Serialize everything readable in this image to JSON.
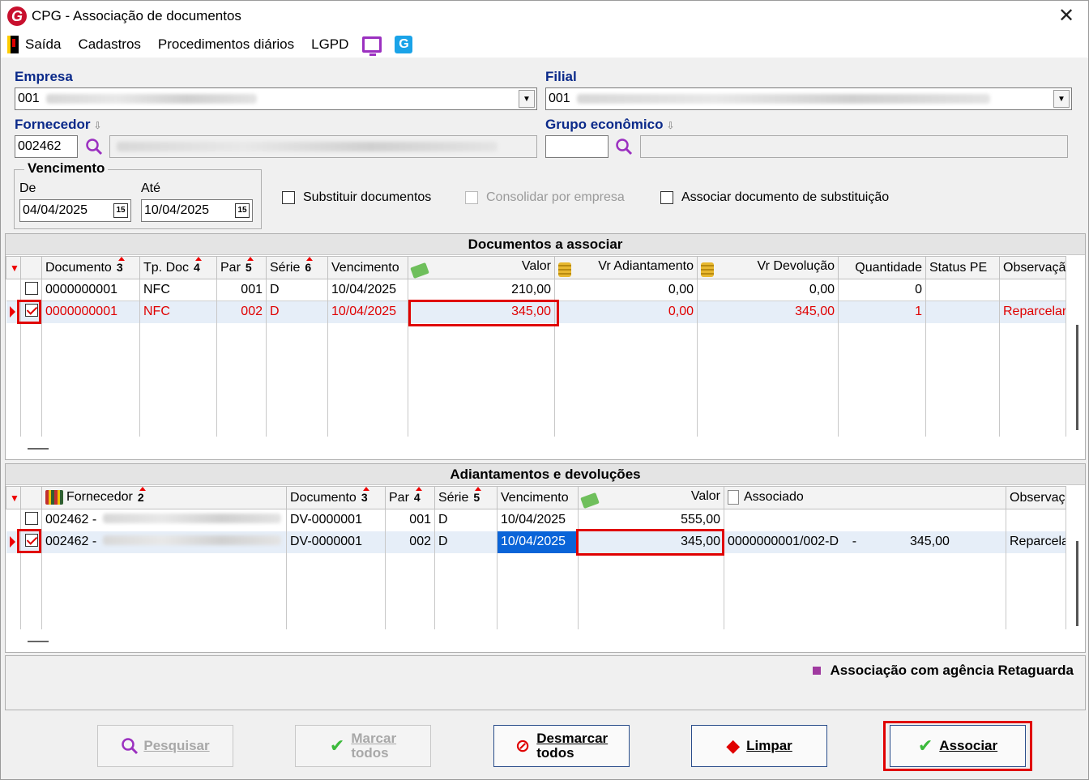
{
  "window": {
    "title": "CPG - Associação de documentos",
    "close": "✕"
  },
  "menu": {
    "items": [
      "Saída",
      "Cadastros",
      "Procedimentos diários",
      "LGPD"
    ]
  },
  "form": {
    "empresa_label": "Empresa",
    "empresa_value": "001",
    "filial_label": "Filial",
    "filial_value": "001",
    "fornecedor_label": "Fornecedor",
    "fornecedor_value": "002462",
    "grupo_label": "Grupo econômico",
    "grupo_value": "",
    "vencimento_label": "Vencimento",
    "de_label": "De",
    "de_value": "04/04/2025",
    "ate_label": "Até",
    "ate_value": "10/04/2025",
    "cal_glyph": "15",
    "chk_substituir": "Substituir documentos",
    "chk_consolidar": "Consolidar por empresa",
    "chk_associar_sub": "Associar documento de substituição"
  },
  "docs": {
    "title": "Documentos a associar",
    "headers": {
      "documento": "Documento",
      "documento_n": "3",
      "tpdoc": "Tp. Doc",
      "tpdoc_n": "4",
      "par": "Par",
      "par_n": "5",
      "serie": "Série",
      "serie_n": "6",
      "vencimento": "Vencimento",
      "valor": "Valor",
      "vradiant": "Vr Adiantamento",
      "vrdevol": "Vr Devolução",
      "quantidade": "Quantidade",
      "status": "Status PE",
      "observacao": "Observaçã"
    },
    "rows": [
      {
        "documento": "0000000001",
        "tpdoc": "NFC",
        "par": "001",
        "serie": "D",
        "vencimento": "10/04/2025",
        "valor": "210,00",
        "vradiant": "0,00",
        "vrdevol": "0,00",
        "quantidade": "0",
        "status": "",
        "observacao": ""
      },
      {
        "documento": "0000000001",
        "tpdoc": "NFC",
        "par": "002",
        "serie": "D",
        "vencimento": "10/04/2025",
        "valor": "345,00",
        "vradiant": "0,00",
        "vrdevol": "345,00",
        "quantidade": "1",
        "status": "",
        "observacao": "Reparcelar"
      }
    ]
  },
  "adiant": {
    "title": "Adiantamentos e devoluções",
    "headers": {
      "fornecedor": "Fornecedor",
      "fornecedor_n": "2",
      "documento": "Documento",
      "documento_n": "3",
      "par": "Par",
      "par_n": "4",
      "serie": "Série",
      "serie_n": "5",
      "vencimento": "Vencimento",
      "valor": "Valor",
      "associado": "Associado",
      "observacao": "Observaçã"
    },
    "rows": [
      {
        "fornecedor": "002462 -",
        "documento": "DV-0000001",
        "par": "001",
        "serie": "D",
        "vencimento": "10/04/2025",
        "valor": "555,00",
        "associado": "",
        "assoc_sep": "",
        "assoc_val": "",
        "observacao": ""
      },
      {
        "fornecedor": "002462 -",
        "documento": "DV-0000001",
        "par": "002",
        "serie": "D",
        "vencimento": "10/04/2025",
        "valor": "345,00",
        "associado": "0000000001/002-D",
        "assoc_sep": "-",
        "assoc_val": "345,00",
        "observacao": "Reparcelar"
      }
    ]
  },
  "legend": {
    "text": "Associação com agência Retaguarda",
    "color": "#a03aa0"
  },
  "buttons": {
    "pesquisar": "Pesquisar",
    "marcar_1": "Marcar",
    "marcar_2": "todos",
    "desmarcar_1": "Desmarcar",
    "desmarcar_2": "todos",
    "limpar": "Limpar",
    "associar": "Associar"
  }
}
